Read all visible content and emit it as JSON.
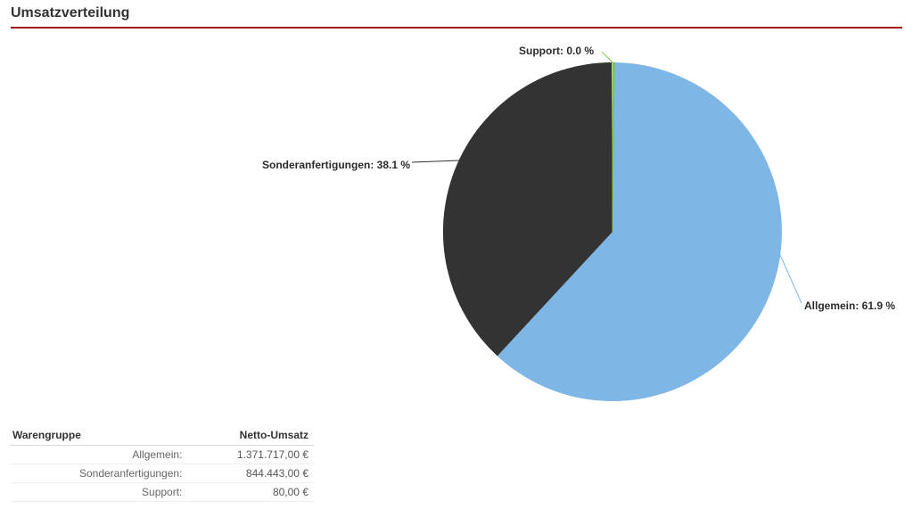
{
  "title": "Umsatzverteilung",
  "chart_data": {
    "type": "pie",
    "title": "Umsatzverteilung",
    "series": [
      {
        "name": "Allgemein",
        "value_label": "61.9 %",
        "percent": 61.9,
        "amount": "1.371.717,00 €",
        "color": "#7eb6e6"
      },
      {
        "name": "Sonderanfertigungen",
        "value_label": "38.1 %",
        "percent": 38.1,
        "amount": "844.443,00 €",
        "color": "#333333"
      },
      {
        "name": "Support",
        "value_label": "0.0 %",
        "percent": 0.0,
        "amount": "80,00 €",
        "color": "#7ac943"
      }
    ],
    "labels": {
      "support": "Support: 0.0 %",
      "allgemein": "Allgemein: 61.9 %",
      "sonder": "Sonderanfertigungen: 38.1 %"
    }
  },
  "table": {
    "headers": {
      "col1": "Warengruppe",
      "col2": "Netto-Umsatz"
    },
    "rows": [
      {
        "label": "Allgemein:",
        "value": "1.371.717,00 €"
      },
      {
        "label": "Sonderanfertigungen:",
        "value": "844.443,00 €"
      },
      {
        "label": "Support:",
        "value": "80,00 €"
      }
    ]
  }
}
